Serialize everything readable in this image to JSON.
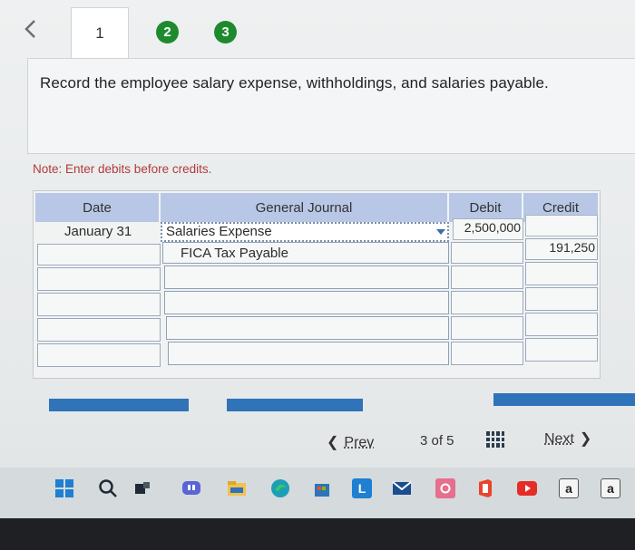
{
  "nav": {
    "back_glyph": "‹",
    "steps": [
      "1",
      "2",
      "3"
    ]
  },
  "question": "Record the employee salary expense, withholdings, and salaries payable.",
  "note": "Note: Enter debits before credits.",
  "journal": {
    "headers": {
      "date": "Date",
      "general_journal": "General Journal",
      "debit": "Debit",
      "credit": "Credit"
    },
    "rows": [
      {
        "date": "January 31",
        "account": "Salaries Expense",
        "debit": "2,500,000",
        "credit": ""
      },
      {
        "date": "",
        "account": "FICA Tax Payable",
        "debit": "",
        "credit": "191,250"
      },
      {
        "date": "",
        "account": "",
        "debit": "",
        "credit": ""
      },
      {
        "date": "",
        "account": "",
        "debit": "",
        "credit": ""
      },
      {
        "date": "",
        "account": "",
        "debit": "",
        "credit": ""
      },
      {
        "date": "",
        "account": "",
        "debit": "",
        "credit": ""
      }
    ]
  },
  "pager": {
    "prev_label": "Prev",
    "page_status": "3 of 5",
    "next_label": "Next"
  },
  "taskbar": {
    "icons": [
      "windows-icon",
      "search-icon",
      "task-view-icon",
      "chat-icon",
      "file-explorer-icon",
      "edge-icon",
      "store-icon",
      "launcher-icon",
      "mail-icon",
      "app-icon",
      "office-icon",
      "youtube-icon",
      "a-app-icon",
      "a-app-icon-2"
    ],
    "labels": {
      "letter_l": "L",
      "letter_a1": "a",
      "letter_a2": "a"
    }
  },
  "colors": {
    "step_green": "#1e8a2e",
    "header_blue": "#b8c7e6",
    "note_red": "#b33a3a",
    "bar_blue": "#2f73b8"
  }
}
